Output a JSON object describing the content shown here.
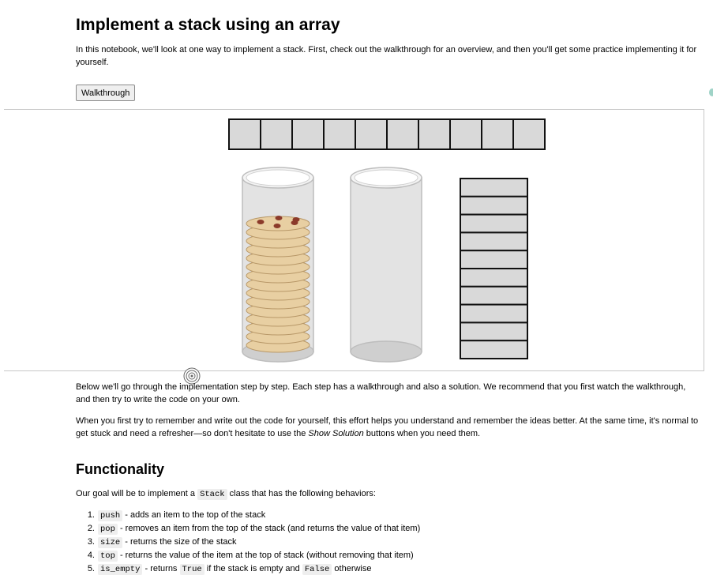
{
  "page": {
    "title": "Implement a stack using an array",
    "intro": "In this notebook, we'll look at one way to implement a stack. First, check out the walkthrough for an overview, and then you'll get some practice implementing it for yourself.",
    "walkthrough_button": "Walkthrough"
  },
  "illustration": {
    "array_cells": 10,
    "cookie_count": 15,
    "stack_slots": 10,
    "colors": {
      "accent_bar": "#42a5f5",
      "cell_fill": "#d9d9d9",
      "cookie": "#e8cfa2",
      "chip": "#8b3a2a"
    }
  },
  "body": {
    "p1": "Below we'll go through the implementation step by step. Each step has a walkthrough and also a solution. We recommend that you first watch the walkthrough, and then try to write the code on your own.",
    "p2_before": "When you first try to remember and write out the code for yourself, this effort helps you understand and remember the ideas better. At the same time, it's normal to get stuck and need a refresher—so don't hesitate to use the ",
    "p2_em": "Show Solution",
    "p2_after": " buttons when you need them."
  },
  "functionality": {
    "heading": "Functionality",
    "goal_before": "Our goal will be to implement a ",
    "goal_code": "Stack",
    "goal_after": " class that has the following behaviors:",
    "items": [
      {
        "num": "1.",
        "code": "push",
        "desc": " - adds an item to the top of the stack"
      },
      {
        "num": "2.",
        "code": "pop",
        "desc": " - removes an item from the top of the stack (and returns the value of that item)"
      },
      {
        "num": "3.",
        "code": "size",
        "desc": " - returns the size of the stack"
      },
      {
        "num": "4.",
        "code": "top",
        "desc": " - returns the value of the item at the top of stack (without removing that item)"
      }
    ],
    "item5": {
      "num": "5.",
      "code": "is_empty",
      "desc1": " - returns ",
      "code2": "True",
      "desc2": " if the stack is empty and ",
      "code3": "False",
      "desc3": " otherwise"
    }
  }
}
